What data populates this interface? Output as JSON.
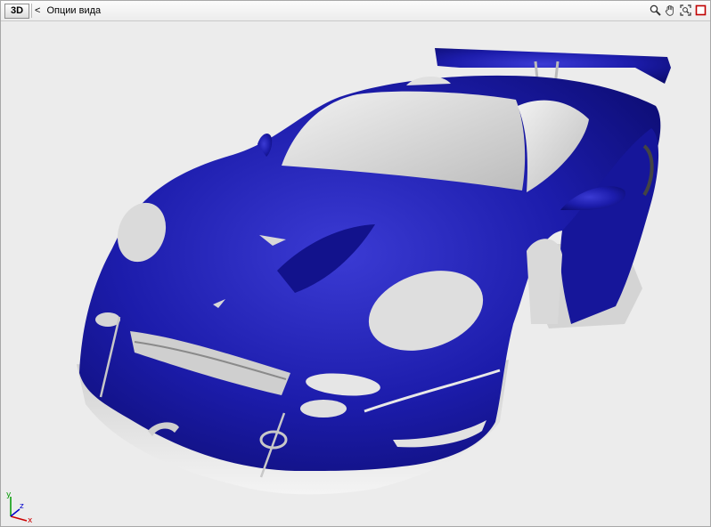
{
  "toolbar": {
    "mode_label": "3D",
    "back_glyph": "<",
    "title": "Опции вида",
    "tools": [
      {
        "name": "zoom-icon"
      },
      {
        "name": "pan-hand-icon"
      },
      {
        "name": "zoom-extents-icon"
      },
      {
        "name": "maximize-viewport-icon"
      }
    ]
  },
  "viewport": {
    "object": "car-body-model",
    "body_color": "#1a1aa8",
    "glass_color": "#d8d8d8",
    "background": "#ececec"
  },
  "axis_gizmo": {
    "x_label": "x",
    "y_label": "y",
    "z_label": "z",
    "x_color": "#cc0000",
    "y_color": "#009900",
    "z_color": "#0000cc"
  }
}
